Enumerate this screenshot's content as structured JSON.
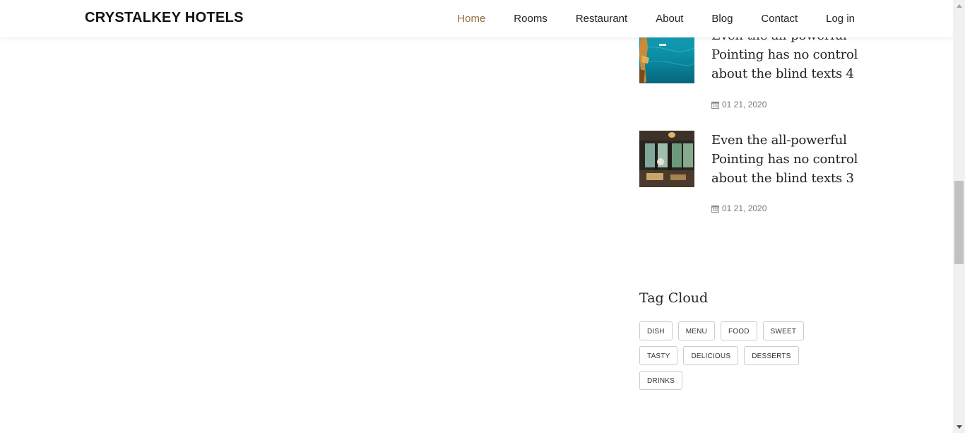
{
  "brand": "CRYSTALKEY HOTELS",
  "nav": {
    "items": [
      "Home",
      "Rooms",
      "Restaurant",
      "About",
      "Blog",
      "Contact",
      "Log in"
    ],
    "active": "Home"
  },
  "posts": [
    {
      "title": "Even the all-powerful Pointing has no control about the blind texts 4",
      "date": "01 21, 2020"
    },
    {
      "title": "Even the all-powerful Pointing has no control about the blind texts 3",
      "date": "01 21, 2020"
    }
  ],
  "tag_cloud": {
    "heading": "Tag Cloud",
    "tags": [
      "DISH",
      "MENU",
      "FOOD",
      "SWEET",
      "TASTY",
      "DELICIOUS",
      "DESSERTS",
      "DRINKS"
    ]
  },
  "colors": {
    "accent": "#8d703b"
  },
  "icons": {
    "date": "calendar-icon",
    "scroll_up": "arrow-up-icon",
    "scroll_down": "arrow-down-icon"
  }
}
